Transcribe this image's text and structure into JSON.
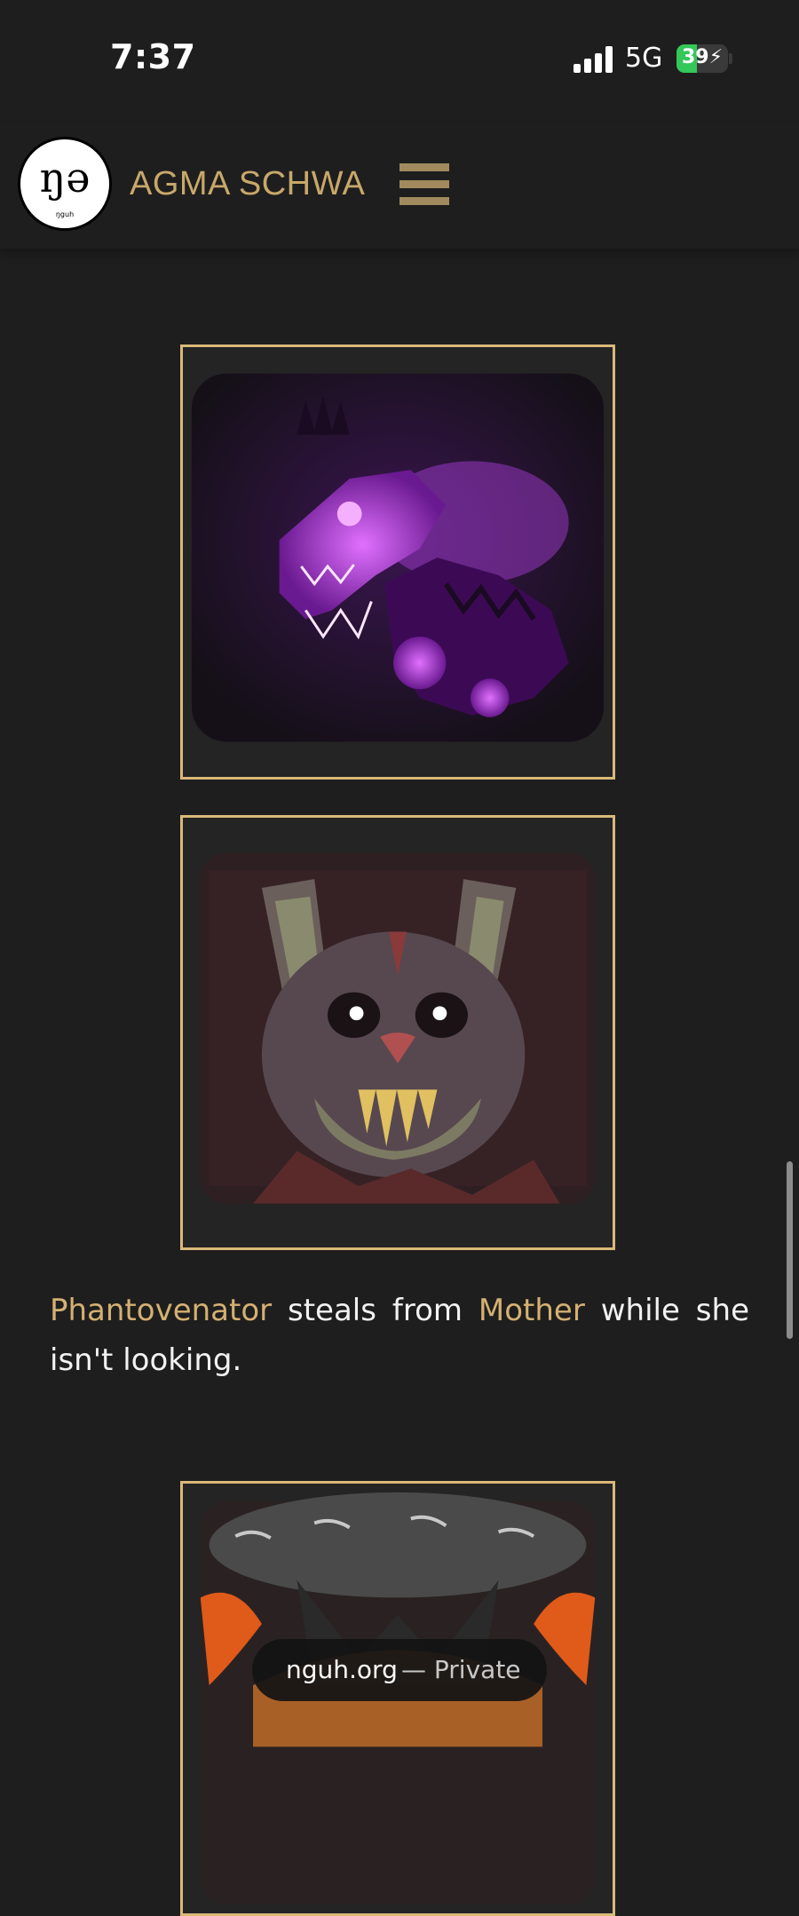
{
  "status_bar": {
    "time": "7:37",
    "network": "5G",
    "battery_level": "39",
    "battery_fraction": 0.39,
    "battery_color": "#34c759"
  },
  "header": {
    "logo_glyph": "ŋə",
    "logo_small_text": "ŋguh",
    "site_name": "AGMA SCHWA",
    "menu_icon": "hamburger-menu-icon"
  },
  "gallery": {
    "images": [
      {
        "subject": "purple glowing skeletal dinosaur creature",
        "accent": "#b040e0"
      },
      {
        "subject": "knitted plush rabbit creature with fangs",
        "accent": "#7a5a6a"
      },
      {
        "subject": "dark horned creature over fire",
        "accent": "#e05a1a"
      }
    ]
  },
  "caption": {
    "link1": "Phantovenator",
    "text1": " steals from ",
    "link2": "Mother",
    "text2": " while she isn't looking."
  },
  "browser": {
    "domain": "nguh.org",
    "mode": "— Private"
  },
  "colors": {
    "background": "#1e1e1e",
    "gold": "#d9b979",
    "link": "#d4b072"
  }
}
